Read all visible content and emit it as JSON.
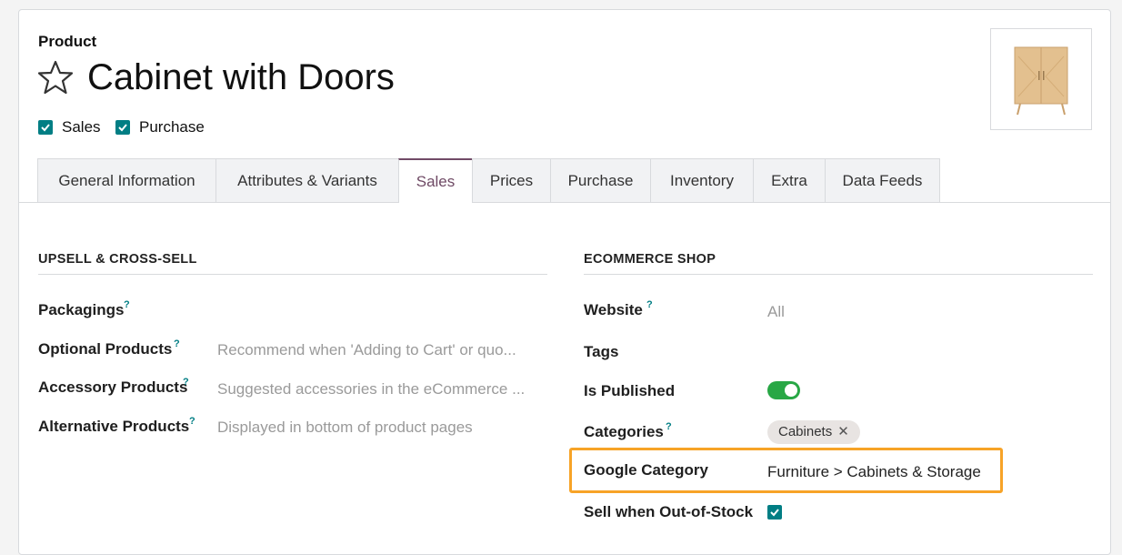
{
  "header": {
    "breadcrumb": "Product",
    "title": "Cabinet with Doors",
    "checkboxes": [
      {
        "label": "Sales",
        "checked": true
      },
      {
        "label": "Purchase",
        "checked": true
      }
    ]
  },
  "tabs": [
    {
      "label": "General Information"
    },
    {
      "label": "Attributes & Variants"
    },
    {
      "label": "Sales",
      "active": true
    },
    {
      "label": "Prices"
    },
    {
      "label": "Purchase"
    },
    {
      "label": "Inventory"
    },
    {
      "label": "Extra"
    },
    {
      "label": "Data Feeds"
    }
  ],
  "upsell": {
    "title": "UPSELL & CROSS-SELL",
    "packagings_label": "Packagings",
    "optional_label": "Optional Products",
    "optional_placeholder": "Recommend when 'Adding to Cart' or quo...",
    "accessory_label": "Accessory Products",
    "accessory_placeholder": "Suggested accessories in the eCommerce ...",
    "alternative_label": "Alternative Products",
    "alternative_placeholder": "Displayed in bottom of product pages"
  },
  "ecommerce": {
    "title": "ECOMMERCE SHOP",
    "website_label": "Website",
    "website_value": "All",
    "tags_label": "Tags",
    "published_label": "Is Published",
    "published": true,
    "categories_label": "Categories",
    "category_tag": "Cabinets",
    "tag_remove": "✕",
    "google_label": "Google Category",
    "google_value": "Furniture > Cabinets & Storage",
    "oos_label": "Sell when Out-of-Stock",
    "oos_checked": true
  },
  "help_mark": "?",
  "colors": {
    "accent": "#017e84",
    "tab_active": "#714b67",
    "toggle_on": "#28a745",
    "highlight": "#f7a327"
  }
}
